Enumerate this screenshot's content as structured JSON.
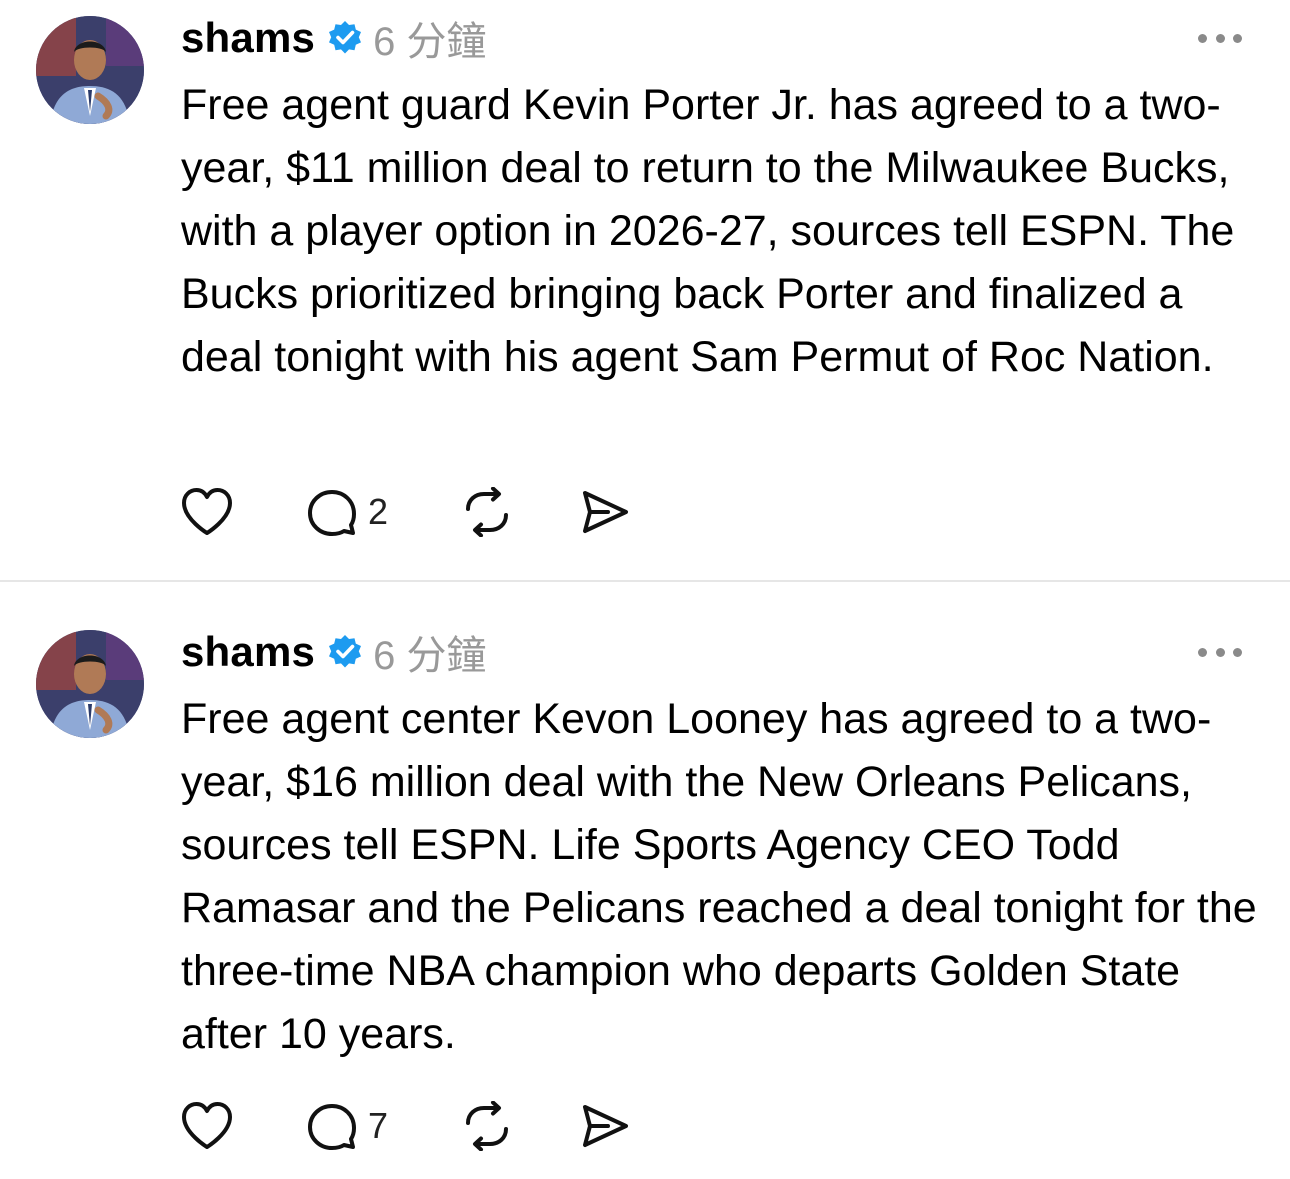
{
  "posts": [
    {
      "username": "shams",
      "timestamp": "6 分鐘",
      "text": "Free agent guard Kevin Porter Jr. has agreed to a two-year, $11 million deal to return to the Milwaukee Bucks, with a player option in 2026-27, sources tell ESPN. The Bucks prioritized bringing back Porter and finalized a deal tonight with his agent Sam Permut of Roc Nation.",
      "reply_count": "2",
      "icons": [
        "heart-icon",
        "comment-icon",
        "repost-icon",
        "share-icon"
      ]
    },
    {
      "username": "shams",
      "timestamp": "6 分鐘",
      "text": "Free agent center Kevon Looney has agreed to a two-year, $16 million deal with the New Orleans Pelicans, sources tell ESPN. Life Sports Agency CEO Todd Ramasar and the Pelicans reached a deal tonight for the three-time NBA champion who departs Golden State after 10 years.",
      "reply_count": "7",
      "icons": [
        "heart-icon",
        "comment-icon",
        "repost-icon",
        "share-icon"
      ]
    }
  ],
  "colors": {
    "verified": "#1D9BF0",
    "timestamp": "#999999",
    "divider": "#e6e6e6"
  }
}
